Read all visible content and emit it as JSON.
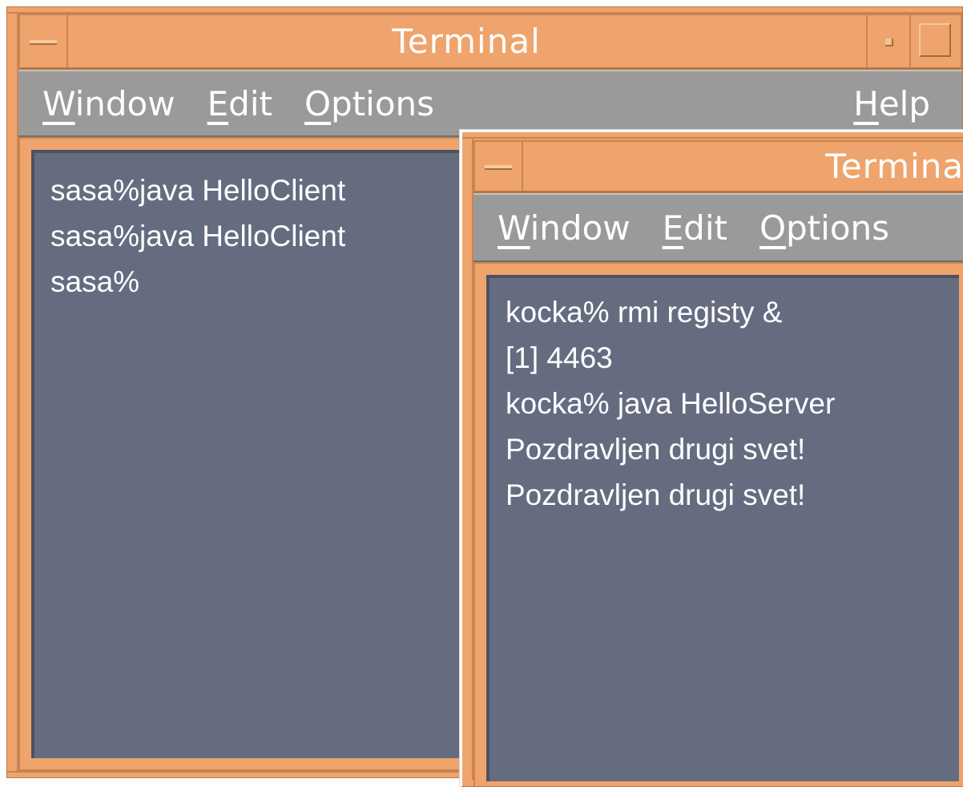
{
  "windows": [
    {
      "title": "Terminal",
      "menu": {
        "window": {
          "u": "W",
          "rest": "indow"
        },
        "edit": {
          "u": "E",
          "rest": "dit"
        },
        "options": {
          "u": "O",
          "rest": "ptions"
        },
        "help": {
          "u": "H",
          "rest": "elp"
        }
      },
      "lines": [
        "sasa%java HelloClient",
        "sasa%java HelloClient",
        "sasa%"
      ]
    },
    {
      "title": "Terminal",
      "menu": {
        "window": {
          "u": "W",
          "rest": "indow"
        },
        "edit": {
          "u": "E",
          "rest": "dit"
        },
        "options": {
          "u": "O",
          "rest": "ptions"
        }
      },
      "lines": [
        "kocka% rmi registy &",
        "[1] 4463",
        "kocka% java HelloServer",
        "Pozdravljen drugi svet!",
        "Pozdravljen drugi svet!"
      ]
    }
  ],
  "colors": {
    "frame": "#eea46c",
    "menubar": "#9a9a9a",
    "terminal_bg": "#666c80",
    "text": "#ffffff"
  },
  "icons": {
    "window_menu": "window-menu-icon",
    "minimize": "minimize-icon",
    "maximize": "maximize-icon"
  }
}
